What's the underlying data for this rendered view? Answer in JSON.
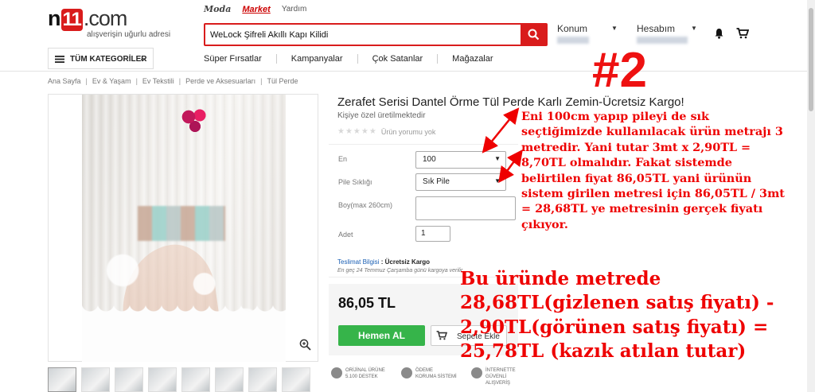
{
  "header": {
    "logo": {
      "n": "n",
      "one": "11",
      "rest": ".com"
    },
    "tagline": "alışverişin uğurlu adresi",
    "toplinks": {
      "moda": "Moda",
      "market": "Market",
      "help": "Yardım"
    },
    "search": {
      "value": "WeLock Şifreli Akıllı Kapı Kilidi"
    },
    "location": {
      "label": "Konum"
    },
    "account": {
      "label": "Hesabım"
    },
    "categories_label": "TÜM KATEGORİLER",
    "nav": [
      "Süper Fırsatlar",
      "Kampanyalar",
      "Çok Satanlar",
      "Mağazalar"
    ]
  },
  "breadcrumb": [
    "Ana Sayfa",
    "Ev & Yaşam",
    "Ev Tekstili",
    "Perde ve Aksesuarları",
    "Tül Perde"
  ],
  "product": {
    "title": "Zerafet Serisi Dantel Örme Tül Perde Karlı Zemin-Ücretsiz Kargo!",
    "note": "Kişiye özel üretilmektedir",
    "rating": {
      "stars": 0,
      "max": 5,
      "text": "Ürün yorumu yok"
    },
    "options": {
      "en": {
        "label": "En",
        "value": "100"
      },
      "pile": {
        "label": "Pile Sıklığı",
        "value": "Sık Pile"
      },
      "boy": {
        "label": "Boy(max 260cm)",
        "value": ""
      },
      "adet": {
        "label": "Adet",
        "value": "1"
      }
    },
    "shipping": {
      "link": "Teslimat Bilgisi",
      "sep": ":",
      "value": "Ücretsiz Kargo",
      "eta": "En geç 24 Temmuz Çarşamba günü kargoya verilir"
    },
    "price": "86,05 TL",
    "buy_label": "Hemen AL",
    "add_label": "Sepete Ekle",
    "badges": [
      {
        "l1": "ORİJİNAL ÜRÜNE",
        "l2": "5.100 DESTEK"
      },
      {
        "l1": "ÖDEME",
        "l2": "KORUMA SİSTEMİ"
      },
      {
        "l1": "İNTERNETTE",
        "l2": "GÜVENLİ ALIŞVERİŞ"
      }
    ],
    "thumbnail_count": 8
  },
  "annotation": {
    "tag": "#2",
    "text": "Eni 100cm yapıp pileyi de sık seçtiğimizde kullanılacak ürün metrajı 3 metredir. Yani tutar 3mt x 2,90TL = 8,70TL olmalıdır. Fakat sistemde belirtilen fiyat 86,05TL yani ürünün sistem girilen metresi için 86,05TL / 3mt = 28,68TL ye metresinin gerçek fiyatı çıkıyor.",
    "big": "Bu üründe metrede 28,68TL(gizlenen satış fiyatı) - 2,90TL(görünen satış fiyatı) = 25,78TL (kazık atılan tutar)"
  },
  "icons": [
    "search-icon",
    "bell-icon",
    "cart-icon",
    "menu-icon",
    "zoom-icon",
    "chevron-down-icon"
  ],
  "colors": {
    "brand": "#d91c1c",
    "buy": "#36b44a",
    "annotation": "#e00000"
  }
}
